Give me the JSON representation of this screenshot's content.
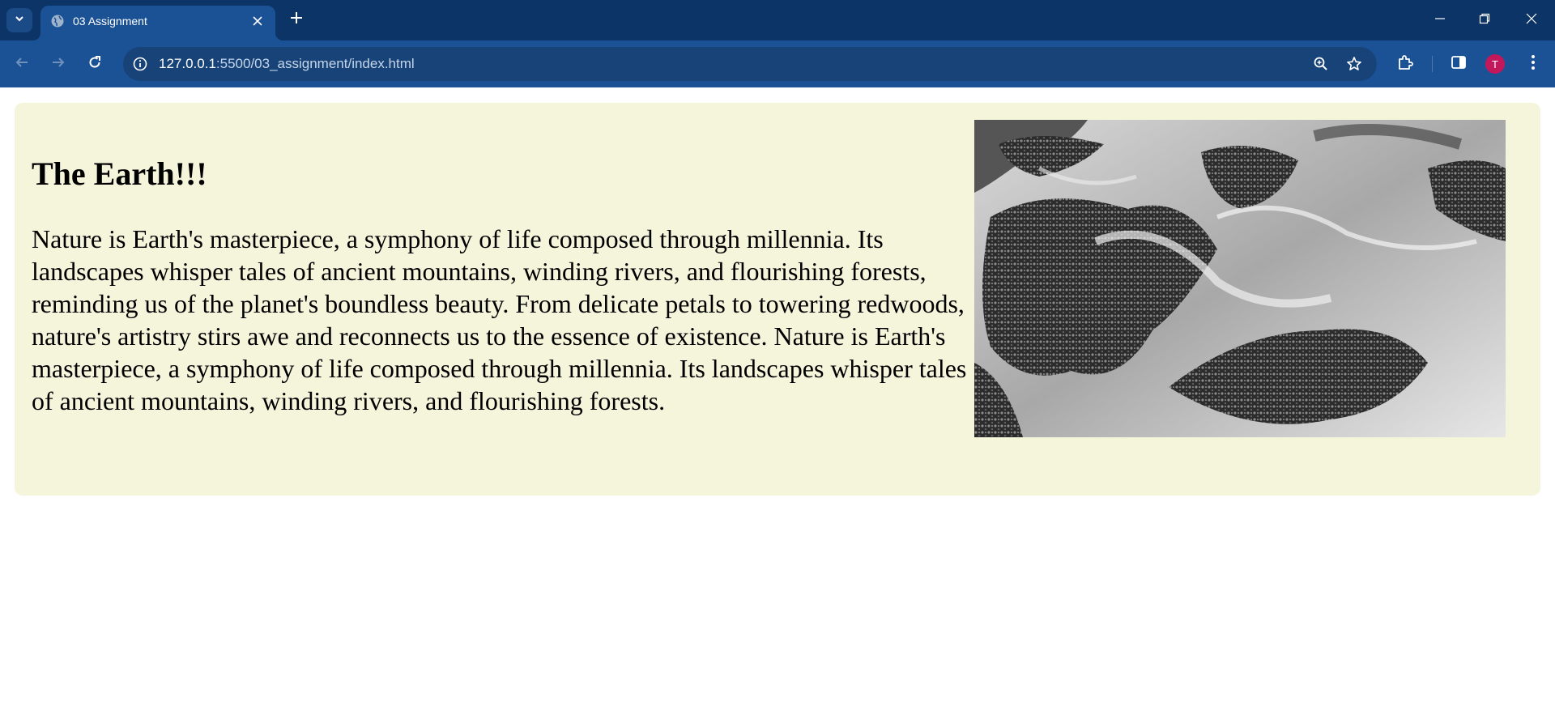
{
  "browser": {
    "tab": {
      "title": "03 Assignment"
    },
    "url": {
      "host": "127.0.0.1",
      "rest": ":5500/03_assignment/index.html"
    },
    "profile_initial": "T"
  },
  "page": {
    "heading": "The Earth!!!",
    "paragraph": "Nature is Earth's masterpiece, a symphony of life composed through millennia. Its landscapes whisper tales of ancient mountains, winding rivers, and flourishing forests, reminding us of the planet's boundless beauty. From delicate petals to towering redwoods, nature's artistry stirs awe and reconnects us to the essence of existence. Nature is Earth's masterpiece, a symphony of life composed through millennia. Its landscapes whisper tales of ancient mountains, winding rivers, and flourishing forests."
  },
  "colors": {
    "tabstrip": "#0d3466",
    "toolbar": "#1b5296",
    "omnibox": "#174378",
    "card_background": "#f5f5dc",
    "avatar": "#c2185b"
  },
  "icons": {
    "tab_search": "chevron-down-icon",
    "favicon": "globe-icon",
    "tab_close": "close-icon",
    "new_tab": "plus-icon",
    "minimize": "minimize-icon",
    "restore": "restore-icon",
    "close_window": "close-icon",
    "back": "back-arrow-icon",
    "forward": "forward-arrow-icon",
    "reload": "reload-icon",
    "site_info": "info-icon",
    "zoom": "zoom-icon",
    "bookmark": "star-icon",
    "extensions": "puzzle-icon",
    "side_panel": "side-panel-icon",
    "menu": "more-vertical-icon"
  }
}
